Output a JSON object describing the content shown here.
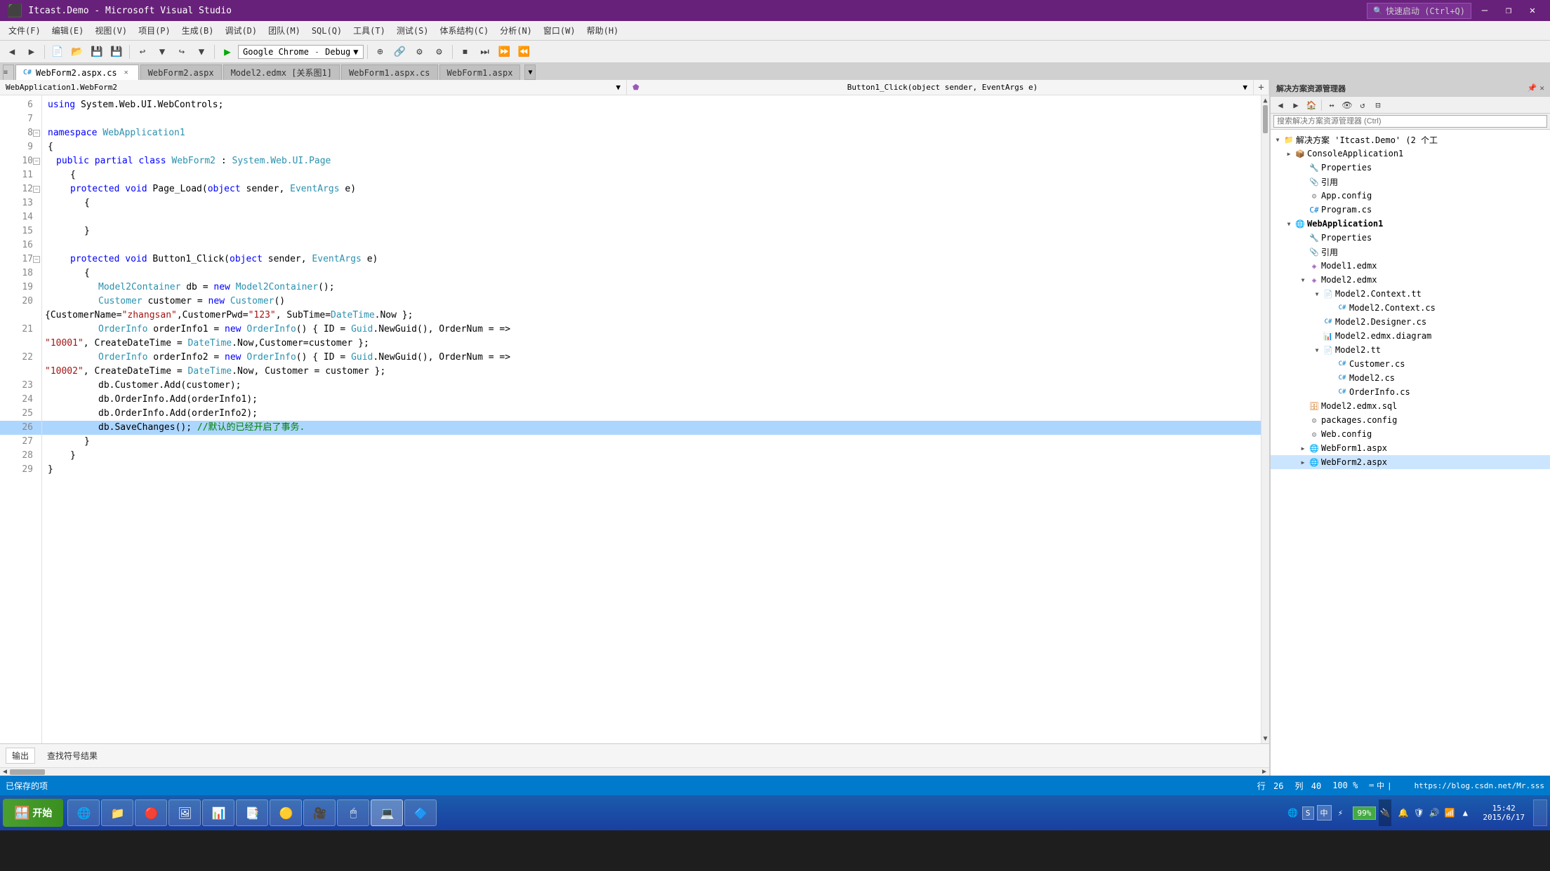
{
  "titlebar": {
    "title": "Itcast.Demo - Microsoft Visual Studio",
    "search_label": "快速启动 (Ctrl+Q)",
    "min_btn": "—",
    "restore_btn": "❐",
    "close_btn": "✕",
    "logo": "VS"
  },
  "menubar": {
    "items": [
      "文件(F)",
      "编辑(E)",
      "视图(V)",
      "项目(P)",
      "生成(B)",
      "调试(D)",
      "团队(M)",
      "SQL(Q)",
      "工具(T)",
      "测试(S)",
      "体系结构(C)",
      "分析(N)",
      "窗口(W)",
      "帮助(H)"
    ]
  },
  "toolbar": {
    "debug_target": "Google Chrome",
    "mode": "Debug",
    "nav_dropdown_arrow": "▼"
  },
  "tabs": {
    "items": [
      {
        "label": "WebForm2.aspx.cs",
        "active": true,
        "closeable": true
      },
      {
        "label": "WebForm2.aspx",
        "active": false,
        "closeable": false
      },
      {
        "label": "Model2.edmx [关系图1]",
        "active": false,
        "closeable": false
      },
      {
        "label": "WebForm1.aspx.cs",
        "active": false,
        "closeable": false
      },
      {
        "label": "WebForm1.aspx",
        "active": false,
        "closeable": false
      }
    ],
    "tab_arrow": "▼"
  },
  "codenav": {
    "left": "WebApplication1.WebForm2",
    "right": "Button1_Click(object sender, EventArgs e)",
    "plus": "+"
  },
  "code": {
    "lines": [
      {
        "num": 6,
        "content": "using System.Web.UI.WebControls;",
        "indent": 0
      },
      {
        "num": 7,
        "content": "",
        "indent": 0
      },
      {
        "num": 8,
        "content": "namespace WebApplication1",
        "indent": 0,
        "has_collapse": true
      },
      {
        "num": 9,
        "content": "{",
        "indent": 0
      },
      {
        "num": 10,
        "content": "public partial class WebForm2 : System.Web.UI.Page",
        "indent": 1,
        "has_collapse": true
      },
      {
        "num": 11,
        "content": "{",
        "indent": 2
      },
      {
        "num": 12,
        "content": "protected void Page_Load(object sender, EventArgs e)",
        "indent": 2,
        "has_collapse": true
      },
      {
        "num": 13,
        "content": "{",
        "indent": 3
      },
      {
        "num": 14,
        "content": "",
        "indent": 0
      },
      {
        "num": 15,
        "content": "}",
        "indent": 3
      },
      {
        "num": 16,
        "content": "",
        "indent": 0
      },
      {
        "num": 17,
        "content": "protected void Button1_Click(object sender, EventArgs e)",
        "indent": 2,
        "has_collapse": true
      },
      {
        "num": 18,
        "content": "{",
        "indent": 3
      },
      {
        "num": 19,
        "content": "Model2Container db = new Model2Container();",
        "indent": 4
      },
      {
        "num": 20,
        "content": "Customer customer = new Customer()",
        "indent": 4
      },
      {
        "num": 20,
        "content": "{CustomerName=\"zhangsan\",CustomerPwd=\"123\", SubTime=DateTime.Now };",
        "indent": 0,
        "is_continuation": true
      },
      {
        "num": 21,
        "content": "OrderInfo orderInfo1 = new OrderInfo() { ID = Guid.NewGuid(), OrderNum = =>",
        "indent": 4
      },
      {
        "num": 21,
        "content": "\"10001\", CreateDateTime = DateTime.Now,Customer=customer };",
        "indent": 0,
        "is_continuation": true
      },
      {
        "num": 22,
        "content": "OrderInfo orderInfo2 = new OrderInfo() { ID = Guid.NewGuid(), OrderNum = =>",
        "indent": 4
      },
      {
        "num": 22,
        "content": "\"10002\", CreateDateTime = DateTime.Now, Customer = customer };",
        "indent": 0,
        "is_continuation": true
      },
      {
        "num": 23,
        "content": "db.Customer.Add(customer);",
        "indent": 4
      },
      {
        "num": 24,
        "content": "db.OrderInfo.Add(orderInfo1);",
        "indent": 4
      },
      {
        "num": 25,
        "content": "db.OrderInfo.Add(orderInfo2);",
        "indent": 4
      },
      {
        "num": 26,
        "content": "db.SaveChanges(); //默认的已经开启了事务.",
        "indent": 4,
        "selected": true
      },
      {
        "num": 27,
        "content": "}",
        "indent": 3
      },
      {
        "num": 28,
        "content": "}",
        "indent": 2
      },
      {
        "num": 29,
        "content": "}",
        "indent": 0
      }
    ]
  },
  "solution_explorer": {
    "title": "解决方案资源管理器",
    "search_placeholder": "搜索解决方案资源管理器 (Ctrl)",
    "tree": {
      "solution_label": "解决方案 'Itcast.Demo' (2 个工",
      "nodes": [
        {
          "label": "ConsoleApplication1",
          "level": 1,
          "type": "project",
          "expanded": false
        },
        {
          "label": "Properties",
          "level": 2,
          "type": "folder"
        },
        {
          "label": "引用",
          "level": 2,
          "type": "refs"
        },
        {
          "label": "App.config",
          "level": 2,
          "type": "file"
        },
        {
          "label": "Program.cs",
          "level": 2,
          "type": "file"
        },
        {
          "label": "WebApplication1",
          "level": 1,
          "type": "project",
          "expanded": true,
          "bold": true
        },
        {
          "label": "Properties",
          "level": 2,
          "type": "folder"
        },
        {
          "label": "引用",
          "level": 2,
          "type": "refs"
        },
        {
          "label": "Model1.edmx",
          "level": 2,
          "type": "edmx"
        },
        {
          "label": "Model2.edmx",
          "level": 2,
          "type": "edmx"
        },
        {
          "label": "Model2.Context.tt",
          "level": 3,
          "type": "tt"
        },
        {
          "label": "Model2.Context.cs",
          "level": 4,
          "type": "cs"
        },
        {
          "label": "Model2.Designer.cs",
          "level": 3,
          "type": "cs"
        },
        {
          "label": "Model2.edmx.diagram",
          "level": 3,
          "type": "diagram"
        },
        {
          "label": "Model2.tt",
          "level": 3,
          "type": "tt"
        },
        {
          "label": "Customer.cs",
          "level": 4,
          "type": "cs"
        },
        {
          "label": "Model2.cs",
          "level": 4,
          "type": "cs"
        },
        {
          "label": "OrderInfo.cs",
          "level": 4,
          "type": "cs"
        },
        {
          "label": "Model2.edmx.sql",
          "level": 2,
          "type": "sql"
        },
        {
          "label": "packages.config",
          "level": 2,
          "type": "config"
        },
        {
          "label": "Web.config",
          "level": 2,
          "type": "config"
        },
        {
          "label": "WebForm1.aspx",
          "level": 2,
          "type": "aspx"
        },
        {
          "label": "WebForm2.aspx",
          "level": 2,
          "type": "aspx",
          "selected": true
        }
      ]
    }
  },
  "bottom_panel": {
    "tabs": [
      "输出",
      "查找符号结果"
    ]
  },
  "statusbar": {
    "saved_text": "已保存的项",
    "row_label": "行",
    "row_value": "26",
    "col_label": "列",
    "col_value": "40",
    "zoom": "100 %",
    "url": "https://blog.csdn.net/Mr.sss"
  },
  "taskbar": {
    "start_label": "开始",
    "apps": [
      {
        "label": "🪟",
        "tooltip": "Windows"
      },
      {
        "label": "🌐",
        "tooltip": "Browser"
      },
      {
        "label": "📁",
        "tooltip": "Explorer"
      },
      {
        "label": "🔴",
        "tooltip": "Chrome"
      },
      {
        "label": "🖼",
        "tooltip": "Photo"
      },
      {
        "label": "📊",
        "tooltip": "Charts"
      },
      {
        "label": "📝",
        "tooltip": "Notepad"
      },
      {
        "label": "🔵",
        "tooltip": "App"
      },
      {
        "label": "🎥",
        "tooltip": "Media"
      },
      {
        "label": "🖱",
        "tooltip": "Mouse"
      },
      {
        "label": "💻",
        "tooltip": "VS"
      },
      {
        "label": "🔷",
        "tooltip": "App2"
      }
    ],
    "clock_time": "15:42",
    "clock_date": "2015/6/17",
    "battery": "99%"
  }
}
